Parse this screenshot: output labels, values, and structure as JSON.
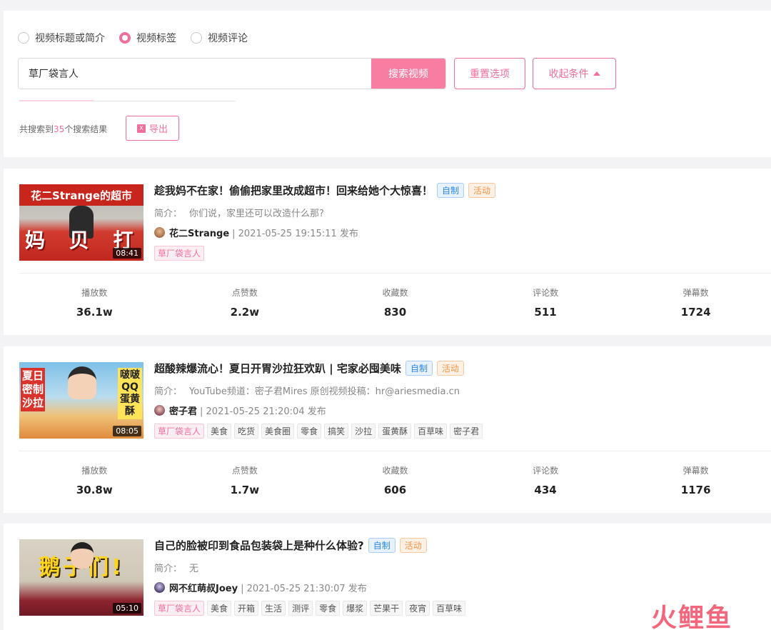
{
  "filter": {
    "radios": [
      {
        "label": "视频标题或简介",
        "checked": false
      },
      {
        "label": "视频标签",
        "checked": true
      },
      {
        "label": "视频评论",
        "checked": false
      }
    ],
    "search_value": "草厂袋言人",
    "search_button": "搜索视频",
    "reset_button": "重置选项",
    "collapse_button": "收起条件",
    "result_prefix": "共搜索到",
    "result_count": "35",
    "result_suffix": "个搜索结果",
    "export_button": "导出"
  },
  "cards": [
    {
      "title": "趁我妈不在家！偷偷把家里改成超市！回来给她个大惊喜！",
      "badge_self": "自制",
      "badge_activity": "活动",
      "intro_label": "简介：",
      "intro": "你们说，家里还可以改造什么那?",
      "author": "花二Strange",
      "publish": "| 2021-05-25 19:15:11 发布",
      "duration": "08:41",
      "thumb_text_top": "花二Strange的超市",
      "thumb_text_bottom": "妈 贝 打",
      "tags": [
        "草厂袋言人"
      ],
      "stats": [
        {
          "label": "播放数",
          "value": "36.1w"
        },
        {
          "label": "点赞数",
          "value": "2.2w"
        },
        {
          "label": "收藏数",
          "value": "830"
        },
        {
          "label": "评论数",
          "value": "511"
        },
        {
          "label": "弹幕数",
          "value": "1724"
        }
      ]
    },
    {
      "title": "超酸辣爆流心！夏日开胃沙拉狂欢趴 | 宅家必囤美味",
      "badge_self": "自制",
      "badge_activity": "活动",
      "intro_label": "简介：",
      "intro": "YouTube频道：密子君Mires 原创视频投稿：hr@ariesmedia.cn",
      "author": "密子君",
      "publish": "| 2021-05-25 21:20:04 发布",
      "duration": "08:05",
      "thumb_text_left": "夏日密制沙拉",
      "thumb_text_right": "啵啵QQ蛋黄酥",
      "tags": [
        "草厂袋言人",
        "美食",
        "吃货",
        "美食圈",
        "零食",
        "搞笑",
        "沙拉",
        "蛋黄酥",
        "百草味",
        "密子君"
      ],
      "stats": [
        {
          "label": "播放数",
          "value": "30.8w"
        },
        {
          "label": "点赞数",
          "value": "1.7w"
        },
        {
          "label": "收藏数",
          "value": "606"
        },
        {
          "label": "评论数",
          "value": "434"
        },
        {
          "label": "弹幕数",
          "value": "1176"
        }
      ]
    },
    {
      "title": "自己的脸被印到食品包装袋上是种什么体验?",
      "badge_self": "自制",
      "badge_activity": "活动",
      "intro_label": "简介：",
      "intro": "无",
      "author": "网不红萌叔Joey",
      "publish": "| 2021-05-25 21:30:07 发布",
      "duration": "05:10",
      "thumb_text": "鹅子们!",
      "tags": [
        "草厂袋言人",
        "美食",
        "开箱",
        "生活",
        "测评",
        "零食",
        "爆浆",
        "芒果干",
        "夜宵",
        "百草味"
      ],
      "stats": []
    }
  ],
  "watermark": "火鲤鱼",
  "colors": {
    "accent": "#f06f9a",
    "self_badge": "#2c86e8",
    "activity_badge": "#f39447"
  }
}
